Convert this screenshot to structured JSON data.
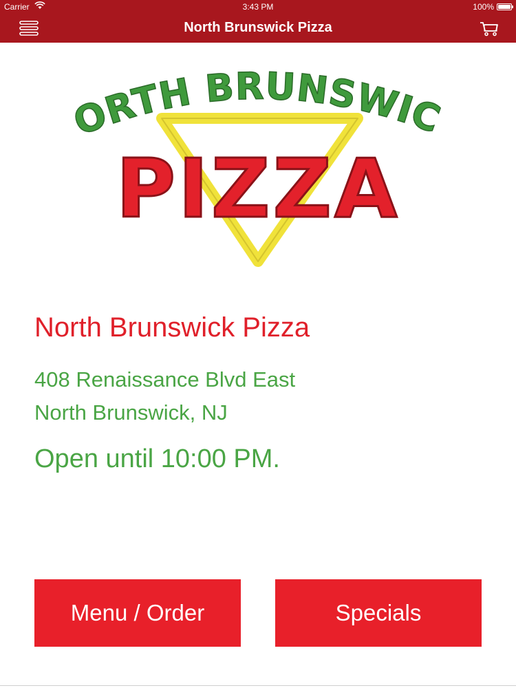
{
  "status_bar": {
    "carrier": "Carrier",
    "time": "3:43 PM",
    "battery": "100%",
    "battery_level": 1.0,
    "wifi_icon": "wifi-icon"
  },
  "nav": {
    "title": "North Brunswick Pizza",
    "menu_icon": "hamburger-icon",
    "cart_icon": "cart-icon",
    "bar_color": "#a8171e"
  },
  "logo": {
    "top_text": "NORTH BRUNSWICK",
    "main_text": "PIZZA",
    "colors": {
      "green": "#3f9a3c",
      "red": "#e3212b",
      "yellow": "#f0e23a"
    }
  },
  "store": {
    "name": "North Brunswick Pizza",
    "address_line1": "408 Renaissance Blvd East",
    "address_line2": "North Brunswick, NJ",
    "hours": "Open until 10:00 PM.",
    "name_color": "#e0202a",
    "text_color": "#4aa545"
  },
  "buttons": {
    "menu_order": "Menu / Order",
    "specials": "Specials",
    "color": "#e8202a"
  }
}
